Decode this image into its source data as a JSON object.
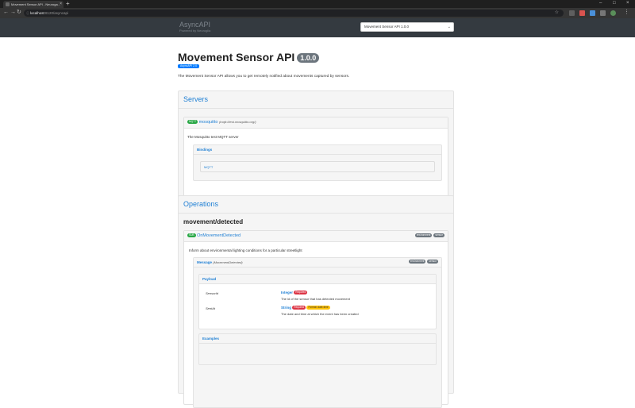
{
  "browser": {
    "tab_title": "Movement Sensor API - Neuroga...",
    "url_host": "localhost",
    "url_path": ":8120/asyncapi",
    "colors": {
      "chrome_dark": "#1f1f1f",
      "chrome_mid": "#353535"
    }
  },
  "header": {
    "brand": "AsyncAPI",
    "brand_sub": "Powered by Neuroglia",
    "select_value": "Movement Sensor API 1.0.0"
  },
  "doc": {
    "title": "Movement Sensor API",
    "version": "1.0.0",
    "spec_badge": "AsyncAPI 2.0",
    "description": "The Movement Sensor API allows you to get remotely notified about movements captured by sensors."
  },
  "servers": {
    "heading": "Servers",
    "items": [
      {
        "protocol": "MQTT",
        "name": "mosquitto",
        "url": "(mqtt://test.mosquitto.org/)",
        "description": "The Mosquitto test MQTT server",
        "bindings_label": "Bindings",
        "binding": "MQTT"
      }
    ]
  },
  "operations": {
    "heading": "Operations",
    "channel": "movement/detected",
    "op": {
      "kind": "SUB",
      "name": "OnMovementDetected",
      "tags": [
        "environment",
        "sensor"
      ],
      "description": "Inform about environmental lighting conditions for a particular streetlight",
      "message_label": "Message",
      "message_name": "(MovementDetected)",
      "message_tags": [
        "environment",
        "sensor"
      ],
      "payload_label": "Payload",
      "fields": [
        {
          "name": "SensorId",
          "type": "Integer",
          "badges": [
            "Required"
          ],
          "desc": "The id of the sensor that has detected movement"
        },
        {
          "name": "SentAt",
          "type": "String",
          "badges": [
            "Required",
            "Format: date-time"
          ],
          "desc": "The date and time at which the event has been created"
        }
      ],
      "examples_label": "Examples"
    }
  }
}
